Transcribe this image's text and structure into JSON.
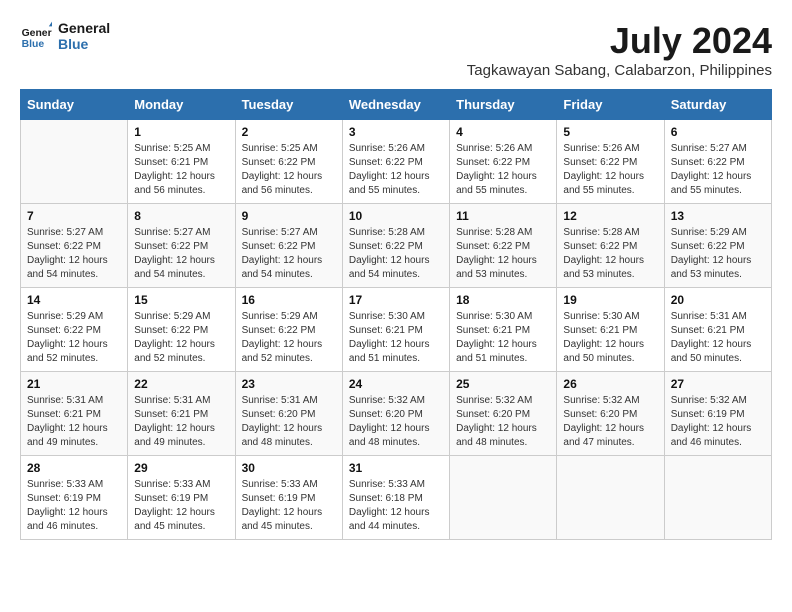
{
  "logo": {
    "line1": "General",
    "line2": "Blue"
  },
  "title": "July 2024",
  "location": "Tagkawayan Sabang, Calabarzon, Philippines",
  "days_header": [
    "Sunday",
    "Monday",
    "Tuesday",
    "Wednesday",
    "Thursday",
    "Friday",
    "Saturday"
  ],
  "weeks": [
    [
      {
        "day": "",
        "info": ""
      },
      {
        "day": "1",
        "info": "Sunrise: 5:25 AM\nSunset: 6:21 PM\nDaylight: 12 hours\nand 56 minutes."
      },
      {
        "day": "2",
        "info": "Sunrise: 5:25 AM\nSunset: 6:22 PM\nDaylight: 12 hours\nand 56 minutes."
      },
      {
        "day": "3",
        "info": "Sunrise: 5:26 AM\nSunset: 6:22 PM\nDaylight: 12 hours\nand 55 minutes."
      },
      {
        "day": "4",
        "info": "Sunrise: 5:26 AM\nSunset: 6:22 PM\nDaylight: 12 hours\nand 55 minutes."
      },
      {
        "day": "5",
        "info": "Sunrise: 5:26 AM\nSunset: 6:22 PM\nDaylight: 12 hours\nand 55 minutes."
      },
      {
        "day": "6",
        "info": "Sunrise: 5:27 AM\nSunset: 6:22 PM\nDaylight: 12 hours\nand 55 minutes."
      }
    ],
    [
      {
        "day": "7",
        "info": "Sunrise: 5:27 AM\nSunset: 6:22 PM\nDaylight: 12 hours\nand 54 minutes."
      },
      {
        "day": "8",
        "info": "Sunrise: 5:27 AM\nSunset: 6:22 PM\nDaylight: 12 hours\nand 54 minutes."
      },
      {
        "day": "9",
        "info": "Sunrise: 5:27 AM\nSunset: 6:22 PM\nDaylight: 12 hours\nand 54 minutes."
      },
      {
        "day": "10",
        "info": "Sunrise: 5:28 AM\nSunset: 6:22 PM\nDaylight: 12 hours\nand 54 minutes."
      },
      {
        "day": "11",
        "info": "Sunrise: 5:28 AM\nSunset: 6:22 PM\nDaylight: 12 hours\nand 53 minutes."
      },
      {
        "day": "12",
        "info": "Sunrise: 5:28 AM\nSunset: 6:22 PM\nDaylight: 12 hours\nand 53 minutes."
      },
      {
        "day": "13",
        "info": "Sunrise: 5:29 AM\nSunset: 6:22 PM\nDaylight: 12 hours\nand 53 minutes."
      }
    ],
    [
      {
        "day": "14",
        "info": "Sunrise: 5:29 AM\nSunset: 6:22 PM\nDaylight: 12 hours\nand 52 minutes."
      },
      {
        "day": "15",
        "info": "Sunrise: 5:29 AM\nSunset: 6:22 PM\nDaylight: 12 hours\nand 52 minutes."
      },
      {
        "day": "16",
        "info": "Sunrise: 5:29 AM\nSunset: 6:22 PM\nDaylight: 12 hours\nand 52 minutes."
      },
      {
        "day": "17",
        "info": "Sunrise: 5:30 AM\nSunset: 6:21 PM\nDaylight: 12 hours\nand 51 minutes."
      },
      {
        "day": "18",
        "info": "Sunrise: 5:30 AM\nSunset: 6:21 PM\nDaylight: 12 hours\nand 51 minutes."
      },
      {
        "day": "19",
        "info": "Sunrise: 5:30 AM\nSunset: 6:21 PM\nDaylight: 12 hours\nand 50 minutes."
      },
      {
        "day": "20",
        "info": "Sunrise: 5:31 AM\nSunset: 6:21 PM\nDaylight: 12 hours\nand 50 minutes."
      }
    ],
    [
      {
        "day": "21",
        "info": "Sunrise: 5:31 AM\nSunset: 6:21 PM\nDaylight: 12 hours\nand 49 minutes."
      },
      {
        "day": "22",
        "info": "Sunrise: 5:31 AM\nSunset: 6:21 PM\nDaylight: 12 hours\nand 49 minutes."
      },
      {
        "day": "23",
        "info": "Sunrise: 5:31 AM\nSunset: 6:20 PM\nDaylight: 12 hours\nand 48 minutes."
      },
      {
        "day": "24",
        "info": "Sunrise: 5:32 AM\nSunset: 6:20 PM\nDaylight: 12 hours\nand 48 minutes."
      },
      {
        "day": "25",
        "info": "Sunrise: 5:32 AM\nSunset: 6:20 PM\nDaylight: 12 hours\nand 48 minutes."
      },
      {
        "day": "26",
        "info": "Sunrise: 5:32 AM\nSunset: 6:20 PM\nDaylight: 12 hours\nand 47 minutes."
      },
      {
        "day": "27",
        "info": "Sunrise: 5:32 AM\nSunset: 6:19 PM\nDaylight: 12 hours\nand 46 minutes."
      }
    ],
    [
      {
        "day": "28",
        "info": "Sunrise: 5:33 AM\nSunset: 6:19 PM\nDaylight: 12 hours\nand 46 minutes."
      },
      {
        "day": "29",
        "info": "Sunrise: 5:33 AM\nSunset: 6:19 PM\nDaylight: 12 hours\nand 45 minutes."
      },
      {
        "day": "30",
        "info": "Sunrise: 5:33 AM\nSunset: 6:19 PM\nDaylight: 12 hours\nand 45 minutes."
      },
      {
        "day": "31",
        "info": "Sunrise: 5:33 AM\nSunset: 6:18 PM\nDaylight: 12 hours\nand 44 minutes."
      },
      {
        "day": "",
        "info": ""
      },
      {
        "day": "",
        "info": ""
      },
      {
        "day": "",
        "info": ""
      }
    ]
  ]
}
